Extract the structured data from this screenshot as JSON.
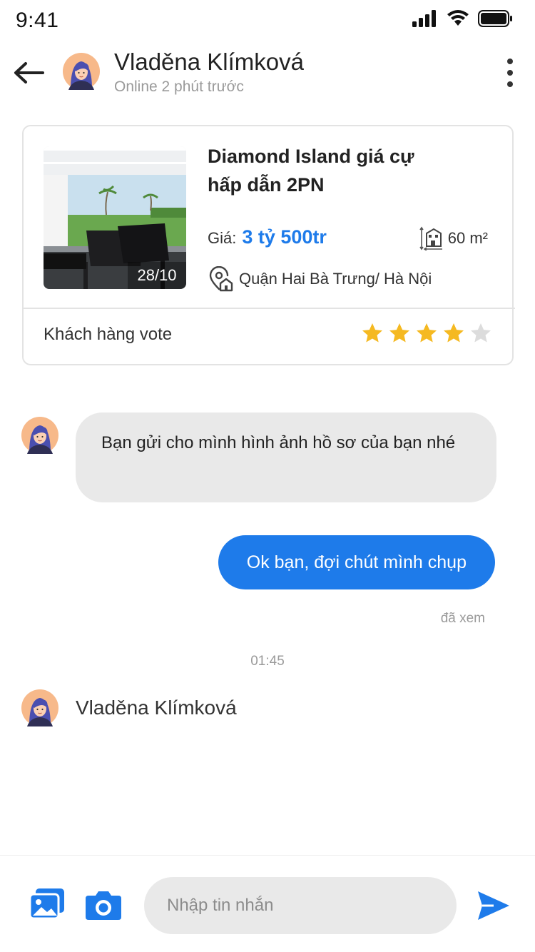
{
  "status_bar": {
    "time": "9:41",
    "icons": [
      "signal-icon",
      "wifi-icon",
      "battery-icon"
    ]
  },
  "header": {
    "name": "Vladěna Klímková",
    "status": "Online 2 phút trước",
    "icons": [
      "back-arrow-icon",
      "more-vertical-icon"
    ]
  },
  "listing": {
    "title": "Diamond Island giá cự hấp dẫn 2PN",
    "image_counter": "28/10",
    "price_label": "Giá:",
    "price_value": "3 tỷ 500tr",
    "area": "60 m²",
    "location": "Quận Hai Bà Trưng/ Hà Nội",
    "vote_label": "Khách hàng vote",
    "rating": 4,
    "rating_max": 5
  },
  "messages": [
    {
      "direction": "incoming",
      "text": "Bạn gửi cho mình hình ảnh hồ sơ của bạn nhé"
    },
    {
      "direction": "outgoing",
      "text": "Ok bạn, đợi chút mình chụp"
    }
  ],
  "seen_label": "đã xem",
  "timestamp": "01:45",
  "last_sender": "Vladěna Klímková",
  "composer": {
    "placeholder": "Nhập tin nhắn",
    "value": "",
    "icons": [
      "gallery-icon",
      "camera-icon",
      "send-icon"
    ]
  },
  "colors": {
    "accent": "#1e7bea",
    "bubble_incoming": "#e9e9e9",
    "star_filled": "#f5b921",
    "star_empty": "#dcdcdc",
    "muted_text": "#9a9a9a"
  }
}
